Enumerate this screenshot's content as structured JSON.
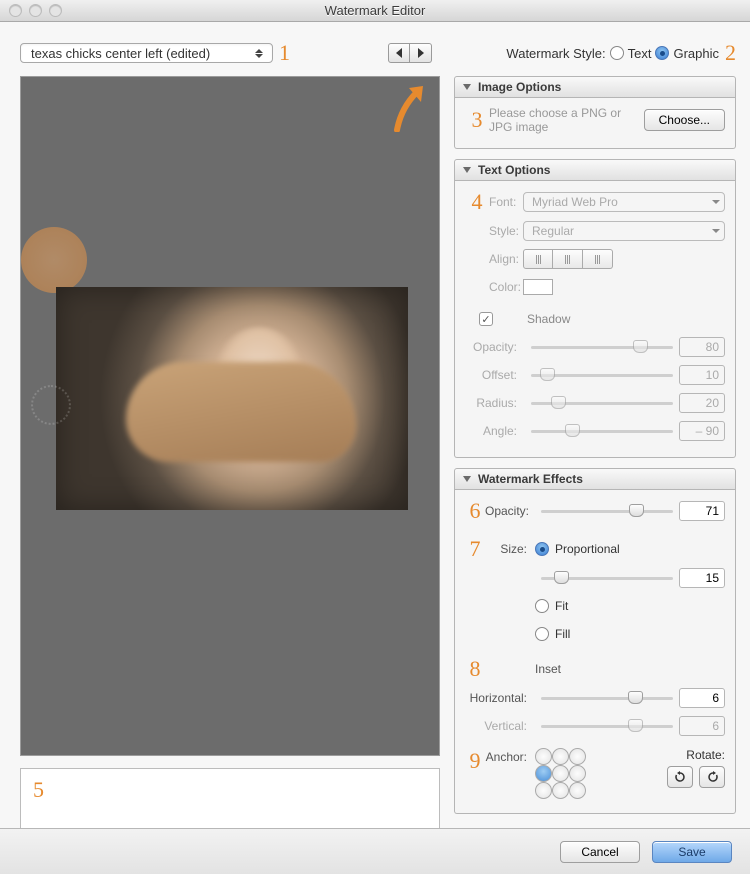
{
  "window": {
    "title": "Watermark Editor"
  },
  "toolbar": {
    "preset_name": "texas chicks center left (edited)",
    "watermark_style_label": "Watermark Style:",
    "style_text": "Text",
    "style_graphic": "Graphic",
    "style_selected": "Graphic"
  },
  "annotations": {
    "a1": "1",
    "a2": "2",
    "a3": "3",
    "a4": "4",
    "a5": "5",
    "a6": "6",
    "a7": "7",
    "a8": "8",
    "a9": "9"
  },
  "panels": {
    "image_options": {
      "title": "Image Options",
      "hint": "Please choose a PNG or JPG image",
      "choose_label": "Choose..."
    },
    "text_options": {
      "title": "Text Options",
      "font_label": "Font:",
      "font_value": "Myriad Web Pro",
      "style_label": "Style:",
      "style_value": "Regular",
      "align_label": "Align:",
      "color_label": "Color:",
      "shadow_label": "Shadow",
      "shadow_enabled": true,
      "opacity_label": "Opacity:",
      "opacity_value": 80,
      "offset_label": "Offset:",
      "offset_value": 10,
      "radius_label": "Radius:",
      "radius_value": 20,
      "angle_label": "Angle:",
      "angle_value": "– 90"
    },
    "watermark_effects": {
      "title": "Watermark Effects",
      "opacity_label": "Opacity:",
      "opacity_value": 71,
      "size_label": "Size:",
      "size_options": {
        "proportional": "Proportional",
        "fit": "Fit",
        "fill": "Fill"
      },
      "size_selected": "Proportional",
      "size_value": 15,
      "inset_label": "Inset",
      "horizontal_label": "Horizontal:",
      "horizontal_value": 6,
      "vertical_label": "Vertical:",
      "vertical_value": 6,
      "anchor_label": "Anchor:",
      "anchor_index": 3,
      "rotate_label": "Rotate:"
    }
  },
  "footer": {
    "cancel": "Cancel",
    "save": "Save"
  },
  "colors": {
    "accent_orange": "#e68a2e"
  }
}
